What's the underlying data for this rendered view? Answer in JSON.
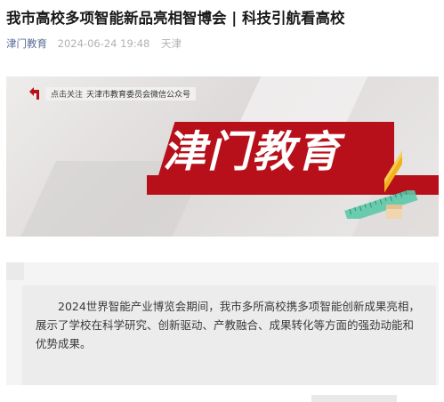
{
  "article": {
    "title": "我市高校多项智能新品亮相智博会 | 科技引航看高校",
    "author": "津门教育",
    "date": "2024-06-24 19:48",
    "location": "天津"
  },
  "banner": {
    "notice_prefix": "点击关注",
    "notice_account": "天津市教育委员会微信公众号",
    "brand": "津门教育",
    "colors": {
      "brand_red": "#b8101b",
      "pencil": "#f2b21b",
      "ruler": "#5cc9a7"
    },
    "icons": [
      "back-arrow-icon",
      "pencil-icon",
      "ruler-icon",
      "eraser-icon"
    ]
  },
  "intro": {
    "text": "2024世界智能产业博览会期间，我市多所高校携多项智能创新成果亮相，展示了学校在科学研究、创新驱动、产教融合、成果转化等方面的强劲动能和优势成果。"
  }
}
